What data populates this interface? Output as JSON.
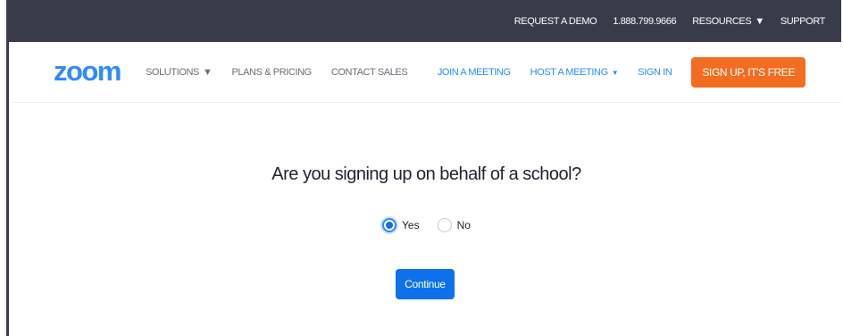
{
  "topbar": {
    "links": [
      "REQUEST A DEMO",
      "1.888.799.9666",
      "RESOURCES",
      "SUPPORT"
    ]
  },
  "navbar": {
    "logo_text": "zoom",
    "left": [
      "SOLUTIONS",
      "PLANS & PRICING",
      "CONTACT SALES"
    ],
    "right": [
      "JOIN A MEETING",
      "HOST A MEETING",
      "SIGN IN"
    ],
    "signup_label": "SIGN UP, IT'S FREE"
  },
  "main": {
    "question": "Are you signing up on behalf of a school?",
    "options": [
      {
        "label": "Yes",
        "selected": true
      },
      {
        "label": "No",
        "selected": false
      }
    ],
    "continue_label": "Continue"
  },
  "colors": {
    "topbar_bg": "#3a3b4a",
    "brand_blue": "#2d8cff",
    "signup_orange": "#f26d21",
    "button_blue": "#0e71eb"
  }
}
